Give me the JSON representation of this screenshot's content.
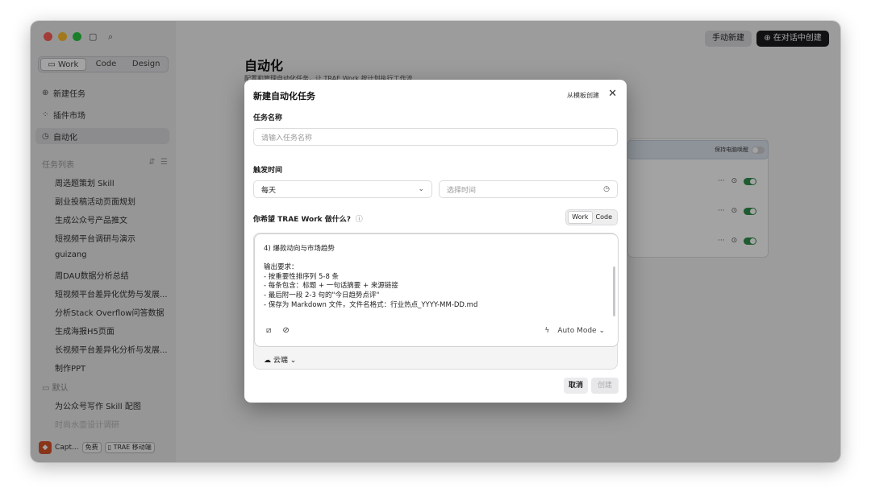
{
  "sidebar": {
    "top_icons": [
      "sidebar-toggle-icon",
      "search-icon"
    ],
    "mode_tabs": [
      {
        "icon": "book-icon",
        "label": "Work"
      },
      {
        "label": "Code"
      },
      {
        "label": "Design"
      }
    ],
    "nav": [
      {
        "icon": "new-task-icon",
        "glyph": "⊕",
        "label": "新建任务"
      },
      {
        "icon": "plugin-icon",
        "glyph": "⁘",
        "label": "插件市场"
      },
      {
        "icon": "clock-icon",
        "glyph": "◷",
        "label": "自动化"
      }
    ],
    "tasks_header": "任务列表",
    "tasks": [
      "周选题策划 Skill",
      "副业投稿活动页面规划",
      "生成公众号产品推文",
      "短视频平台调研与演示",
      "guizang",
      "周DAU数据分析总结",
      "短视频平台差异化优势与发展...",
      "分析Stack Overflow问答数据",
      "生成海报H5页面",
      "长视频平台差异化分析与发展...",
      "制作PPT"
    ],
    "default_group": "默认",
    "default_tasks": [
      "为公众号写作 Skill 配图",
      "时尚水壶设计调研"
    ],
    "user": {
      "name": "Capt...",
      "plan_badge": "免费",
      "mobile_badge": "TRAE 移动端"
    }
  },
  "main": {
    "manual_btn": "手动新建",
    "chat_btn": "在对话中创建",
    "title": "自动化",
    "subtitle": "配置和管理自动化任务，让 TRAE Work 按计划执行工作流",
    "keep_awake": "保持电脑唤醒",
    "rows": 3
  },
  "modal": {
    "title": "新建自动化任务",
    "template_link": "从模板创建",
    "name_label": "任务名称",
    "name_placeholder": "请输入任务名称",
    "trigger_label": "触发时间",
    "frequency": "每天",
    "time_placeholder": "选择时间",
    "prompt_label": "你希望 TRAE Work 做什么?",
    "agent_options": [
      "Work",
      "Code"
    ],
    "prompt_text": "4) 爆款动向与市场趋势\n\n输出要求：\n- 按重要性排序列 5-8 条\n- 每条包含：标题 + 一句话摘要 + 来源链接\n- 最后附一段 2-3 句的\"今日趋势点评\"\n- 保存为 Markdown 文件，文件名格式：行业热点_YYYY-MM-DD.md",
    "mode": "Auto Mode",
    "env": "云端",
    "cancel": "取消",
    "create": "创建"
  },
  "colors": {
    "accent_dark": "#1c1c1e",
    "toggle_on": "#2f8f4c",
    "traffic": [
      "#fe5f57",
      "#febc2e",
      "#28c840"
    ]
  }
}
